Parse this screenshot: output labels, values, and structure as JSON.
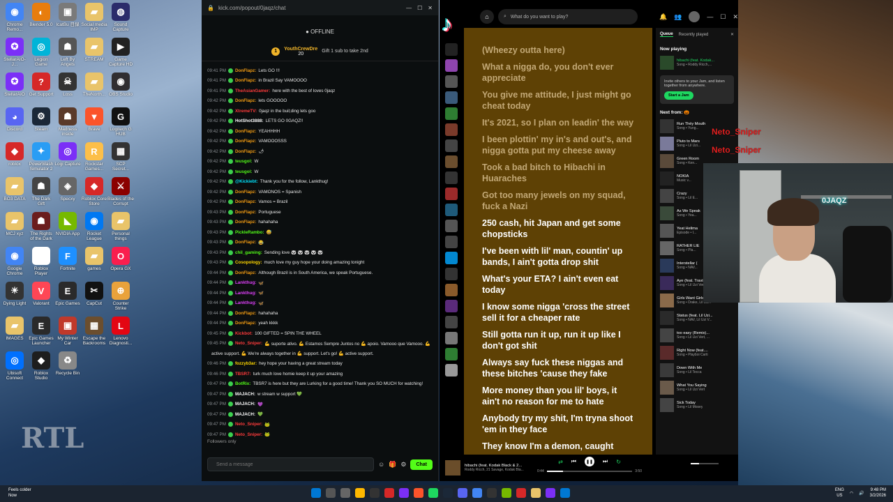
{
  "desktop": {
    "icons": [
      {
        "label": "Chrome Remo...",
        "color": "#4285f4",
        "glyph": "◉"
      },
      {
        "label": "Blender 5.0",
        "color": "#e87d0d",
        "glyph": "◐"
      },
      {
        "label": "IcatBu 目録",
        "color": "#7a7a7a",
        "glyph": "▣"
      },
      {
        "label": "Social media IMP",
        "color": "#e9c46a",
        "glyph": "▰"
      },
      {
        "label": "Sound Capture",
        "color": "#2b2b6b",
        "glyph": "◍"
      },
      {
        "label": "StellarAIO-J...",
        "color": "#7b2ff7",
        "glyph": "✪"
      },
      {
        "label": "Legion Game",
        "color": "#00b4d8",
        "glyph": "◎"
      },
      {
        "label": "Left By Angels",
        "color": "#555",
        "glyph": "☗"
      },
      {
        "label": "STREAM",
        "color": "#e9c46a",
        "glyph": "▰"
      },
      {
        "label": "Game Capture HD",
        "color": "#222",
        "glyph": "▶"
      },
      {
        "label": "StellarAIO",
        "color": "#7b2ff7",
        "glyph": "✪"
      },
      {
        "label": "Get Support",
        "color": "#d62828",
        "glyph": "?"
      },
      {
        "label": "Loss",
        "color": "#333",
        "glyph": "☠"
      },
      {
        "label": "TheNorth...",
        "color": "#e9c46a",
        "glyph": "▰"
      },
      {
        "label": "OBS Studio",
        "color": "#302e31",
        "glyph": "◉"
      },
      {
        "label": "Discord",
        "color": "#5865f2",
        "glyph": "◕"
      },
      {
        "label": "Steam",
        "color": "#1b2838",
        "glyph": "⚙"
      },
      {
        "label": "Madness inside",
        "color": "#5a3a2a",
        "glyph": "☗"
      },
      {
        "label": "Brave",
        "color": "#fb542b",
        "glyph": "▼"
      },
      {
        "label": "Logitech G HUB",
        "color": "#111",
        "glyph": "G"
      },
      {
        "label": "roblox",
        "color": "#d62828",
        "glyph": "◆"
      },
      {
        "label": "PowerWash Simulator 2",
        "color": "#2a9df4",
        "glyph": "✦"
      },
      {
        "label": "Logi Capture",
        "color": "#7b2ff7",
        "glyph": "◎"
      },
      {
        "label": "Rockstar Games...",
        "color": "#fcbf49",
        "glyph": "R"
      },
      {
        "label": "SCP Secret...",
        "color": "#333",
        "glyph": "▦"
      },
      {
        "label": "BO3 DATA",
        "color": "#e9c46a",
        "glyph": "▰"
      },
      {
        "label": "The Dark Gift",
        "color": "#444",
        "glyph": "☗"
      },
      {
        "label": "Specxy",
        "color": "#666",
        "glyph": "◈"
      },
      {
        "label": "Roblox Core Store",
        "color": "#d62828",
        "glyph": "◆"
      },
      {
        "label": "Blades of the Corrupt",
        "color": "#8b0000",
        "glyph": "⚔"
      },
      {
        "label": "MCJ xyz",
        "color": "#e9c46a",
        "glyph": "▰"
      },
      {
        "label": "The Rights of the Dark",
        "color": "#6b1d1d",
        "glyph": "☗"
      },
      {
        "label": "NVIDIA App",
        "color": "#76b900",
        "glyph": "◣"
      },
      {
        "label": "Rocket League",
        "color": "#0078f2",
        "glyph": "◉"
      },
      {
        "label": "Personal things",
        "color": "#e9c46a",
        "glyph": "▰"
      },
      {
        "label": "Google Chrome",
        "color": "#4285f4",
        "glyph": "◉"
      },
      {
        "label": "Roblox Player",
        "color": "#fff",
        "glyph": "◆"
      },
      {
        "label": "Fortnite",
        "color": "#1e90ff",
        "glyph": "F"
      },
      {
        "label": "games",
        "color": "#e9c46a",
        "glyph": "▰"
      },
      {
        "label": "Opera GX",
        "color": "#fa1e4e",
        "glyph": "O"
      },
      {
        "label": "Dying Light",
        "color": "#333",
        "glyph": "☀"
      },
      {
        "label": "Valorant",
        "color": "#ff4655",
        "glyph": "V"
      },
      {
        "label": "Epic Games",
        "color": "#2a2a2a",
        "glyph": "E"
      },
      {
        "label": "CapCut",
        "color": "#111",
        "glyph": "✂"
      },
      {
        "label": "Counter Strike",
        "color": "#e9a23b",
        "glyph": "⊕"
      },
      {
        "label": "IMAGES",
        "color": "#e9c46a",
        "glyph": "▰"
      },
      {
        "label": "Epic Games Launcher",
        "color": "#2a2a2a",
        "glyph": "E"
      },
      {
        "label": "My Winter Car",
        "color": "#c0392b",
        "glyph": "▣"
      },
      {
        "label": "Escape the Backrooms",
        "color": "#6b4e2e",
        "glyph": "▦"
      },
      {
        "label": "Lenovo Diagnosti...",
        "color": "#e30613",
        "glyph": "L"
      },
      {
        "label": "Ubisoft Connect",
        "color": "#0070ff",
        "glyph": "◎"
      },
      {
        "label": "Roblox Studio",
        "color": "#1e1e1e",
        "glyph": "◆"
      },
      {
        "label": "Recycle Bin",
        "color": "#888",
        "glyph": "♻"
      }
    ],
    "watermark": "RTL"
  },
  "chat": {
    "url": "kick.com/popout/0jaqz/chat",
    "status": "OFFLINE",
    "sub_user": "YouthCrewDre",
    "sub_count": "20",
    "gift_text": "Gift 1 sub to take 2nd",
    "messages": [
      {
        "time": "09:41 PM",
        "user": "DonFlapz:",
        "color": "#f39c12",
        "text": "Lets GO !!!"
      },
      {
        "time": "09:41 PM",
        "user": "DonFlapz:",
        "color": "#f39c12",
        "text": "in Brazil Say VAMOOOO"
      },
      {
        "time": "09:41 PM",
        "user": "TheAsianGamer:",
        "color": "#ff3b3b",
        "text": "here with the best of loves 0jaqz"
      },
      {
        "time": "09:42 PM",
        "user": "DonFlapz:",
        "color": "#f39c12",
        "text": "lets GOOOOO"
      },
      {
        "time": "09:42 PM",
        "user": "XtremeTV:",
        "color": "#ff3b3b",
        "text": "0jaqz in the buil;ding lets goo"
      },
      {
        "time": "09:42 PM",
        "user": "HotShot3888:",
        "color": "#ffffff",
        "text": "LETS GO 0GAQZ!!"
      },
      {
        "time": "09:42 PM",
        "user": "DonFlapz:",
        "color": "#f39c12",
        "text": "YEAHHHH"
      },
      {
        "time": "09:42 PM",
        "user": "DonFlapz:",
        "color": "#f39c12",
        "text": "VAMOOOSSS"
      },
      {
        "time": "09:42 PM",
        "user": "DonFlapz:",
        "color": "#f39c12",
        "text": "🌶"
      },
      {
        "time": "09:42 PM",
        "user": "teusgol:",
        "color": "#53fc18",
        "text": "W"
      },
      {
        "time": "09:42 PM",
        "user": "teusgol:",
        "color": "#53fc18",
        "text": "W"
      },
      {
        "time": "09:42 PM",
        "user": "@Kickiebt:",
        "color": "#00e5ff",
        "text": "Thank you for the follow, Lankthug!"
      },
      {
        "time": "09:42 PM",
        "user": "DonFlapz:",
        "color": "#f39c12",
        "text": "VAMONOS = Spanish"
      },
      {
        "time": "09:42 PM",
        "user": "DonFlapz:",
        "color": "#f39c12",
        "text": "Vamos = Brazil"
      },
      {
        "time": "09:43 PM",
        "user": "DonFlapz:",
        "color": "#f39c12",
        "text": "Portuguese"
      },
      {
        "time": "09:43 PM",
        "user": "DonFlapz:",
        "color": "#f39c12",
        "text": "hahahaha"
      },
      {
        "time": "09:43 PM",
        "user": "PickleRambo:",
        "color": "#53fc18",
        "text": "😅"
      },
      {
        "time": "09:43 PM",
        "user": "DonFlapz:",
        "color": "#f39c12",
        "text": "😂"
      },
      {
        "time": "09:43 PM",
        "user": "chil_gaming:",
        "color": "#53fc18",
        "text": "Sending love 🐼 🐼 🐼 🐼 🐼"
      },
      {
        "time": "09:43 PM",
        "user": "Cosopology:",
        "color": "#ffd700",
        "text": "much love my guy hope your doing amazing tonight"
      },
      {
        "time": "09:44 PM",
        "user": "DonFlapz:",
        "color": "#f39c12",
        "text": "Although Brazil is in South America, we speak Portuguese."
      },
      {
        "time": "09:44 PM",
        "user": "Lankthug:",
        "color": "#e040fb",
        "text": "🦋"
      },
      {
        "time": "09:44 PM",
        "user": "Lankthug:",
        "color": "#e040fb",
        "text": "🦋"
      },
      {
        "time": "09:44 PM",
        "user": "Lankthug:",
        "color": "#e040fb",
        "text": "🦋"
      },
      {
        "time": "09:44 PM",
        "user": "DonFlapz:",
        "color": "#f39c12",
        "text": "hahahaha"
      },
      {
        "time": "09:44 PM",
        "user": "DonFlapz:",
        "color": "#f39c12",
        "text": "yeah kkkk"
      },
      {
        "time": "09:45 PM",
        "user": "Kickbot:",
        "color": "#ff3b3b",
        "text": "100 GIFTED = SPIN THE WHEEL"
      },
      {
        "time": "09:45 PM",
        "user": "Neto_Sniper:",
        "color": "#ff3b3b",
        "text": "💪 suporte ativo. 💪 Estamos Sempre Juntos no 💪 apoio. Vamooo que Vamooo. 💪"
      },
      {
        "time": "",
        "user": "",
        "color": "#ffffff",
        "text": "active support. 💪 We're always together in 💪 support. Let's go! 💪 active support."
      },
      {
        "time": "09:46 PM",
        "user": "fozzyb3ar:",
        "color": "#ffd700",
        "text": "hey hope your having a great stream today"
      },
      {
        "time": "09:46 PM",
        "user": "TBSR7:",
        "color": "#ff3b3b",
        "text": "turk much love homie keep it up your amazing"
      },
      {
        "time": "09:47 PM",
        "user": "BotRix:",
        "color": "#53fc18",
        "text": "TBSR7 is here but they are Lurking for a good time! Thank you SO MUCH for watching!"
      },
      {
        "time": "09:47 PM",
        "user": "MAJACH:",
        "color": "#ffffff",
        "text": "w stream w support 💚"
      },
      {
        "time": "09:47 PM",
        "user": "MAJACH:",
        "color": "#ffffff",
        "text": "💜"
      },
      {
        "time": "09:47 PM",
        "user": "MAJACH:",
        "color": "#ffffff",
        "text": "💚"
      },
      {
        "time": "09:47 PM",
        "user": "Neto_Sniper:",
        "color": "#ff3b3b",
        "text": "🐸"
      },
      {
        "time": "09:47 PM",
        "user": "Neto_Sniper:",
        "color": "#ff3b3b",
        "text": "🐸"
      }
    ],
    "followers_only": "Followers only",
    "input_placeholder": "Send a message",
    "chat_button": "Chat"
  },
  "spotify": {
    "search_placeholder": "What do you want to play?",
    "lyrics": [
      {
        "text": "(Wheezy outta here)",
        "state": "past"
      },
      {
        "text": "What a nigga do, you don't ever appreciate",
        "state": "past"
      },
      {
        "text": "You give me attitude, I just might go cheat today",
        "state": "past"
      },
      {
        "text": "It's 2021, so I plan on leadin' the way",
        "state": "past"
      },
      {
        "text": "I been plottin' my in's and out's, and nigga gotta put my cheese away",
        "state": "past"
      },
      {
        "text": "Took a bad bitch to Hibachi in Huaraches",
        "state": "past"
      },
      {
        "text": "Got too many jewels on my squad, fuck a Nazi",
        "state": "past"
      },
      {
        "text": "250 cash, hit Japan and get some chopsticks",
        "state": "active"
      },
      {
        "text": "I've been with lil' man, countin' up bands, I ain't gotta drop shit",
        "state": "next"
      },
      {
        "text": "What's your ETA? I ain't even eat today",
        "state": "next"
      },
      {
        "text": "I know some nigga 'cross the street sell it for a cheaper rate",
        "state": "next"
      },
      {
        "text": "Still gotta run it up, run it up like I don't got shit",
        "state": "next"
      },
      {
        "text": "Always say fuck these niggas and these bitches 'cause they fake",
        "state": "next"
      },
      {
        "text": "More money than you lil' boys, it ain't no reason for me to hate",
        "state": "next"
      },
      {
        "text": "Anybody try my shit, I'm tryna shoot 'em in they face",
        "state": "next"
      },
      {
        "text": "They know I'm a demon, caught",
        "state": "next"
      }
    ],
    "queue": {
      "tab_queue": "Queue",
      "tab_recent": "Recently played",
      "now_playing_label": "Now playing",
      "now_playing": {
        "title": "hibachi (feat. Kodak...",
        "sub": "Song • Roddy Ricch,..."
      },
      "jam_text": "Invite others to your Jam, and listen together from anywhere.",
      "jam_button": "Start a Jam",
      "next_from_label": "Next from: 🎃",
      "items": [
        {
          "title": "Run Thëy Mouth",
          "sub": "Song • Yung..."
        },
        {
          "title": "Pluto to Mars",
          "sub": "Song • Lil Uzi..."
        },
        {
          "title": "Green Room",
          "sub": "Song • Ken..."
        },
        {
          "title": "NOKIA",
          "sub": "Music v..."
        },
        {
          "title": "Crazy",
          "sub": "Song • Lil E..."
        },
        {
          "title": "As We Speak",
          "sub": "Song • Yea..."
        },
        {
          "title": "Yeat Helima",
          "sub": "Episode • I..."
        },
        {
          "title": "RATHER LIE",
          "sub": "Song • Pla..."
        },
        {
          "title": "Interstellar (",
          "sub": "Song • NAV..."
        },
        {
          "title": "Aye (feat. Travis...",
          "sub": "Song • Lil Uzi Vert,..."
        },
        {
          "title": "Girls Want Girls (wi...",
          "sub": "Song • Drake, Lil Ba..."
        },
        {
          "title": "Status (feat. Lil Uzi...",
          "sub": "Song • NAV, Lil Uzi V..."
        },
        {
          "title": "too easy (Remix)...",
          "sub": "Song • Lil Uzi Vert, ..."
        },
        {
          "title": "Right Now (feat....",
          "sub": "Song • Playboi Carti"
        },
        {
          "title": "Down With Me",
          "sub": "Song • Lil Tecca"
        },
        {
          "title": "What You Saying",
          "sub": "Song • Lil Uzi Vert"
        },
        {
          "title": "Sick Today",
          "sub": "Song • Lil Mosey"
        }
      ]
    },
    "player": {
      "title": "hibachi (feat. Kodak Black & 2...",
      "sub": "Roddy Ricch, 21 Savage, Kodak Bla...",
      "elapsed": "0:44",
      "duration": "3:50",
      "progress": 0.19,
      "volume": 0.3
    }
  },
  "overlay": {
    "name1": "Neto_Sniper",
    "name2": "Neto_Sniper",
    "cam_sign": "0JAQZ"
  },
  "taskbar": {
    "weather_temp": "Feels colder",
    "weather_sub": "Now",
    "lang": "ENG",
    "region": "US",
    "time": "9:48 PM",
    "date": "3/2/2026"
  }
}
